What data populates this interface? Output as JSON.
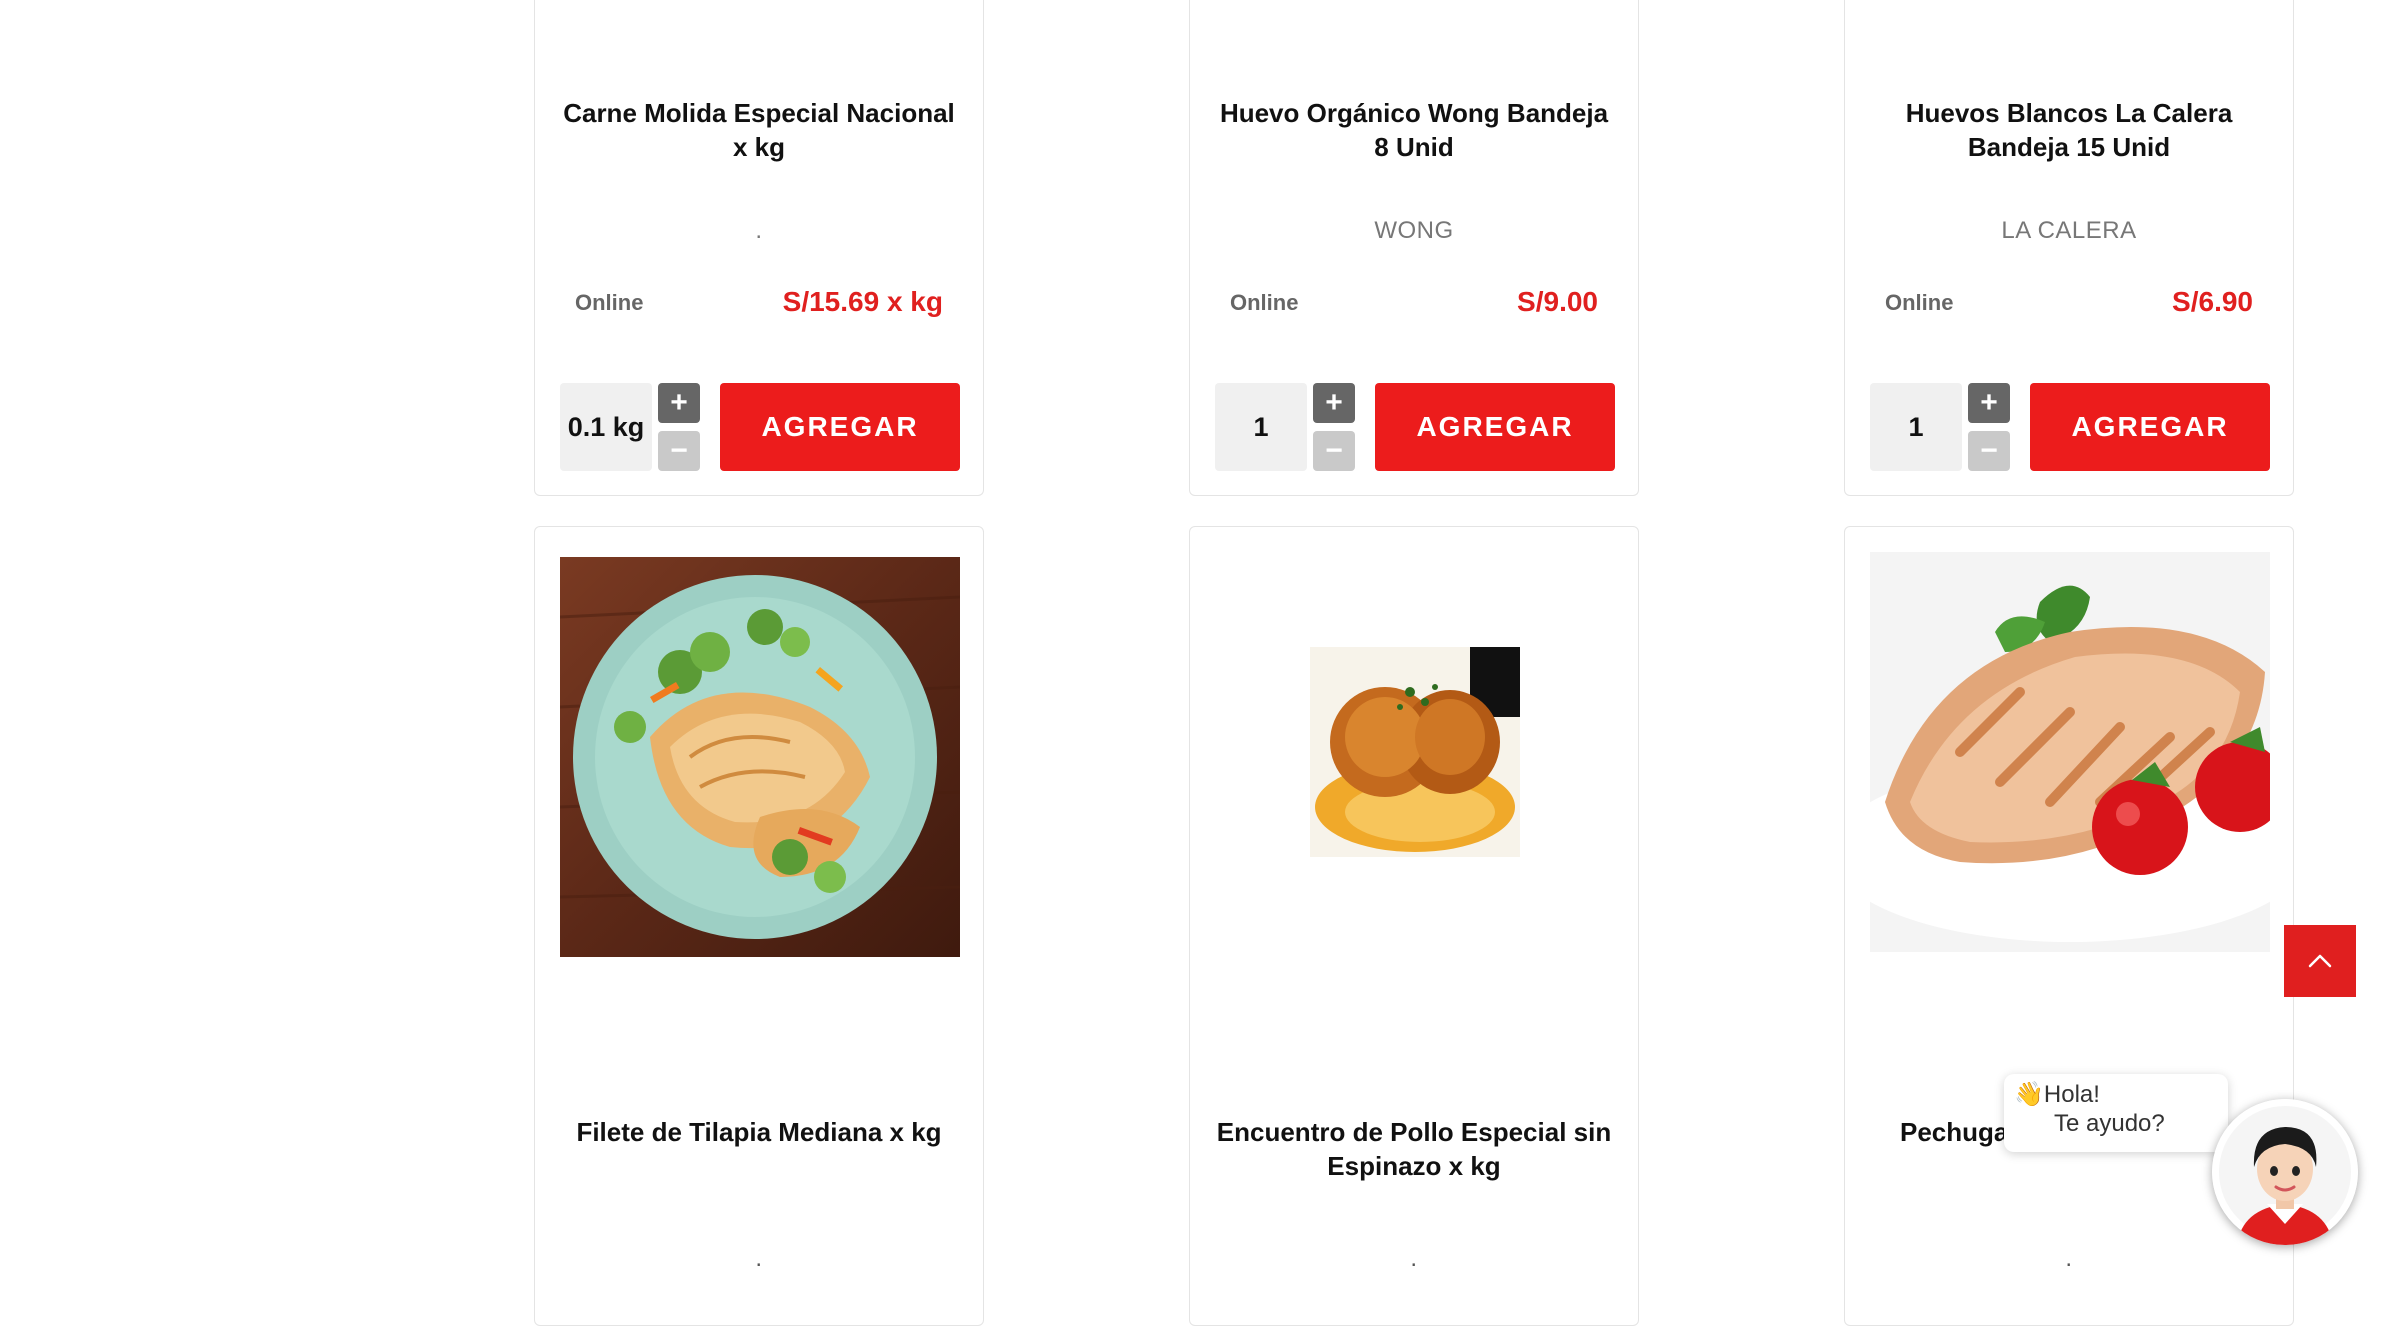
{
  "products_top": [
    {
      "name": "Carne Molida Especial Nacional x kg",
      "brand": ".",
      "channel": "Online",
      "price": "S/15.69 x kg",
      "quantity": "0.1 kg",
      "add_label": "AGREGAR"
    },
    {
      "name": "Huevo Orgánico Wong Bandeja 8 Unid",
      "brand": "WONG",
      "channel": "Online",
      "price": "S/9.00",
      "quantity": "1",
      "add_label": "AGREGAR"
    },
    {
      "name": "Huevos Blancos La Calera Bandeja 15 Unid",
      "brand": "LA CALERA",
      "channel": "Online",
      "price": "S/6.90",
      "quantity": "1",
      "add_label": "AGREGAR"
    }
  ],
  "products_bottom": [
    {
      "name": "Filete de Tilapia Mediana x kg",
      "brand": ".",
      "image": "grilled-tilapia-plate"
    },
    {
      "name": "Encuentro de Pollo Especial sin Espinazo x kg",
      "brand": ".",
      "image": "roasted-chicken"
    },
    {
      "name": "Pechuga",
      "brand": ".",
      "image": "grilled-chicken-breast"
    }
  ],
  "stepper": {
    "plus_symbol": "+",
    "minus_symbol": "−"
  },
  "chat": {
    "greeting": "👋Hola!",
    "prompt": "Te ayudo?"
  },
  "icons": {
    "scroll_top": "chevron-up-icon",
    "chat_avatar": "assistant-avatar-icon"
  },
  "colors": {
    "accent": "#ec1c1c",
    "price": "#e0201f"
  }
}
